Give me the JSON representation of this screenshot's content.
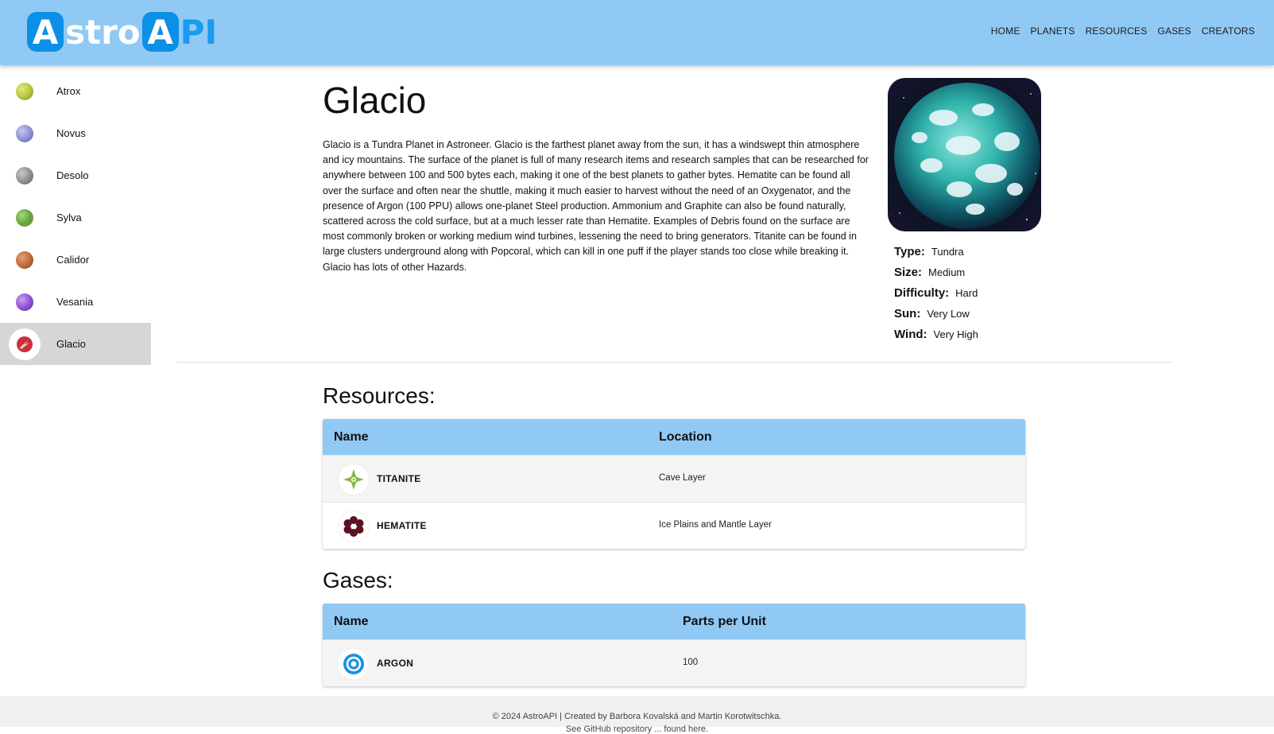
{
  "brand": {
    "part1": "stro",
    "part2": "PI",
    "badge_letter": "A"
  },
  "nav": [
    {
      "label": "HOME"
    },
    {
      "label": "PLANETS"
    },
    {
      "label": "RESOURCES"
    },
    {
      "label": "GASES"
    },
    {
      "label": "CREATORS"
    }
  ],
  "sidebar": {
    "items": [
      {
        "label": "Atrox",
        "color": "#b5c33a"
      },
      {
        "label": "Novus",
        "color": "#8a8ed0"
      },
      {
        "label": "Desolo",
        "color": "#8d8d8d"
      },
      {
        "label": "Sylva",
        "color": "#5fa43c"
      },
      {
        "label": "Calidor",
        "color": "#c0683a"
      },
      {
        "label": "Vesania",
        "color": "#8b4fd6"
      },
      {
        "label": "Glacio",
        "color": "#c8303c",
        "active": true
      }
    ]
  },
  "planet": {
    "name": "Glacio",
    "description": "Glacio is a Tundra Planet in Astroneer. Glacio is the farthest planet away from the sun, it has a windswept thin atmosphere and icy mountains. The surface of the planet is full of many research items and research samples that can be researched for anywhere between 100 and 500 bytes each, making it one of the best planets to gather bytes. Hematite can be found all over the surface and often near the shuttle, making it much easier to harvest without the need of an Oxygenator, and the presence of Argon (100 PPU) allows one-planet Steel production. Ammonium and Graphite can also be found naturally, scattered across the cold surface, but at a much lesser rate than Hematite. Examples of Debris found on the surface are most commonly broken or working medium wind turbines, lessening the need to bring generators. Titanite can be found in large clusters underground along with Popcoral, which can kill in one puff if the player stands too close while breaking it. Glacio has lots of other Hazards.",
    "stats": [
      {
        "key": "Type:",
        "value": "Tundra"
      },
      {
        "key": "Size:",
        "value": "Medium"
      },
      {
        "key": "Difficulty:",
        "value": "Hard"
      },
      {
        "key": "Sun:",
        "value": "Very Low"
      },
      {
        "key": "Wind:",
        "value": "Very High"
      }
    ]
  },
  "resources": {
    "title": "Resources:",
    "columns": [
      "Name",
      "Location"
    ],
    "rows": [
      {
        "name": "TITANITE",
        "location": "Cave Layer",
        "color": "#8ab83e"
      },
      {
        "name": "HEMATITE",
        "location": "Ice Plains and Mantle Layer",
        "color": "#5c1020"
      }
    ]
  },
  "gases": {
    "title": "Gases:",
    "columns": [
      "Name",
      "Parts per Unit"
    ],
    "rows": [
      {
        "name": "ARGON",
        "ppu": "100",
        "color": "#1d8fe0"
      }
    ]
  },
  "footer": {
    "line1": "© 2024 AstroAPI | Created by Barbora Kovalská and Martin Korotwitschka.",
    "line2": "See GitHub repository ... found here."
  }
}
